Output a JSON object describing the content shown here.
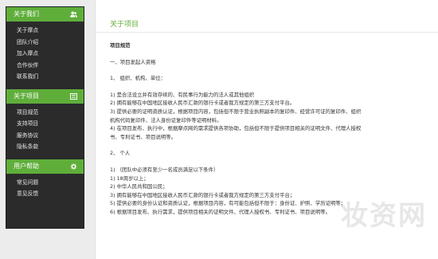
{
  "sidebar": {
    "sections": [
      {
        "title": "关于我们",
        "icon": "users-icon",
        "items": [
          "关于摩点",
          "团队介绍",
          "加入摩点",
          "合作伙伴",
          "联系我们"
        ]
      },
      {
        "title": "关于项目",
        "icon": "list-icon",
        "items": [
          "项目规范",
          "支持项目",
          "服务协议",
          "隐私条款"
        ]
      },
      {
        "title": "用户帮助",
        "icon": "gear-icon",
        "items": [
          "常见问题",
          "意见反馈"
        ]
      }
    ]
  },
  "main": {
    "title": "关于项目",
    "subtitle": "项目规范",
    "section_heading": "一、项目发起人资格",
    "org_heading": "1、  组织、机构、单位：",
    "org_items": [
      "1)    是合法设立并有效存续的、有民事行为能力的法人或其他组织",
      "2)    拥有能够在中国地区接收人民币汇款的银行卡或者我方规定的第三方支付平台。",
      "3)    提供必要的证明资质认证，根据项目内容，包括但不限于营业执照副本的复印件、经营许可证的复印件、组织",
      "机构代码复印件、法人身份证复印件等证明材料。",
      "4)    在项目发布、执行中，根据摩点网的需求提供各项协助，包括但不限于提供项目相关的证明文件、代理人授权",
      "书、专利证书、项目说明等。"
    ],
    "person_heading": "2、   个人",
    "person_items": [
      "1)    （团队中必须有至少一名成员满足以下条件）",
      "1)    18周岁以上；",
      "2)    中华人民共和国公民；",
      "3)    拥有能够在中国地区接收人民币汇款的银行卡或者我方规定的第三方支付平台；",
      "5)    提供必要的身份认证和资质认证，根据项目内容，有可能包括但不限于：身份证、护照、学历证明等；",
      "6)    根据项目发布、执行需求，提供项目相关的证明文件、代理人授权书、专利证书、项目说明等。"
    ],
    "watermark": "妆资网"
  }
}
